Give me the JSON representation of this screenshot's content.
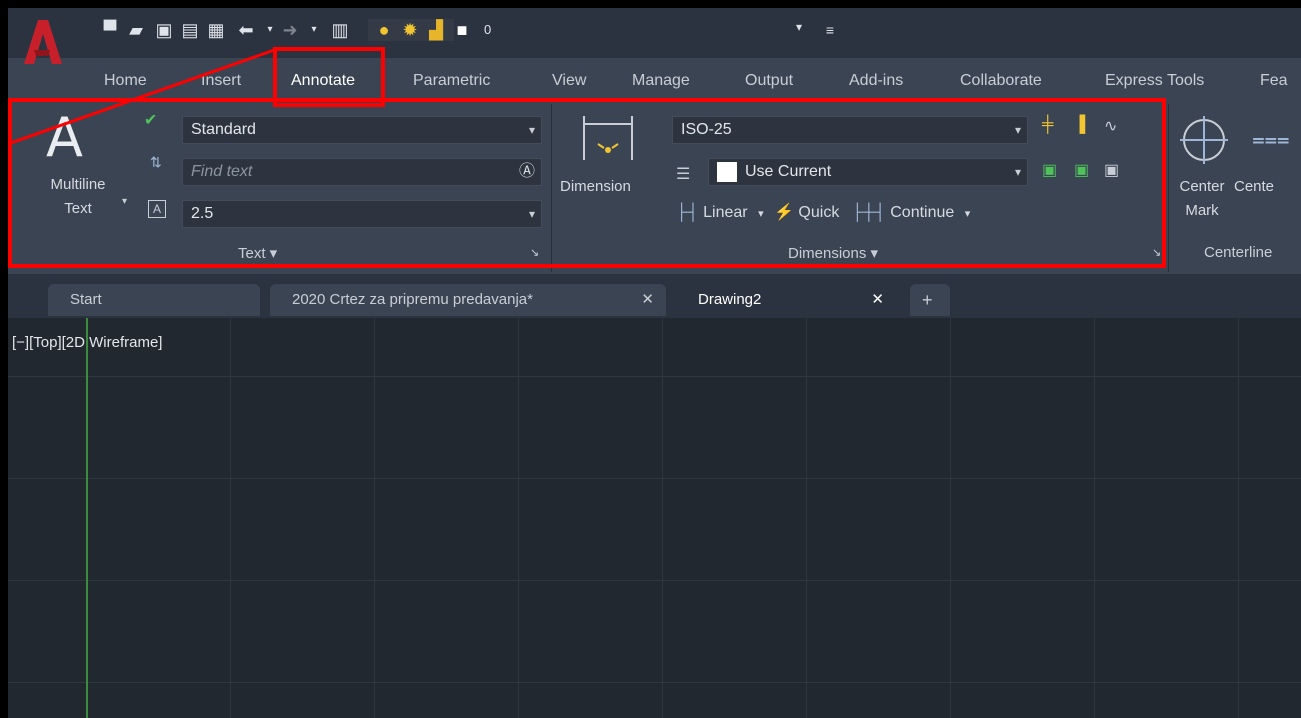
{
  "quick_access": {
    "layer_value": "0",
    "icons": [
      "new-icon",
      "open-icon",
      "save-icon",
      "save-as-icon",
      "print-icon",
      "undo-icon",
      "redo-icon",
      "calculator-icon",
      "lightbulb-icon",
      "sun-icon",
      "lock-icon",
      "color-swatch-icon"
    ]
  },
  "ribbon_tabs": [
    "Home",
    "Insert",
    "Annotate",
    "Parametric",
    "View",
    "Manage",
    "Output",
    "Add-ins",
    "Collaborate",
    "Express Tools",
    "Fea"
  ],
  "text_panel": {
    "big_button_line1": "Multiline",
    "big_button_line2": "Text",
    "style_value": "Standard",
    "find_placeholder": "Find text",
    "height_value": "2.5",
    "panel_title": "Text ▾"
  },
  "dimensions_panel": {
    "big_button": "Dimension",
    "dimstyle_value": "ISO-25",
    "layer_value": "Use Current",
    "linear_label": "Linear",
    "quick_label": "Quick",
    "continue_label": "Continue",
    "panel_title": "Dimensions ▾"
  },
  "centerlines_panel": {
    "center_mark_line1": "Center",
    "center_mark_line2": "Mark",
    "centerline_label": "Cente",
    "panel_title": "Centerline"
  },
  "doc_tabs": {
    "start": "Start",
    "drawing1": "2020 Crtez za pripremu predavanja*",
    "drawing2": "Drawing2",
    "close_glyph": "✕",
    "add_glyph": "+"
  },
  "viewport": {
    "label": "[−][Top][2D Wireframe]"
  },
  "colors": {
    "highlight": "#ff0000",
    "accent_red": "#c8202a",
    "background": "#212830"
  }
}
